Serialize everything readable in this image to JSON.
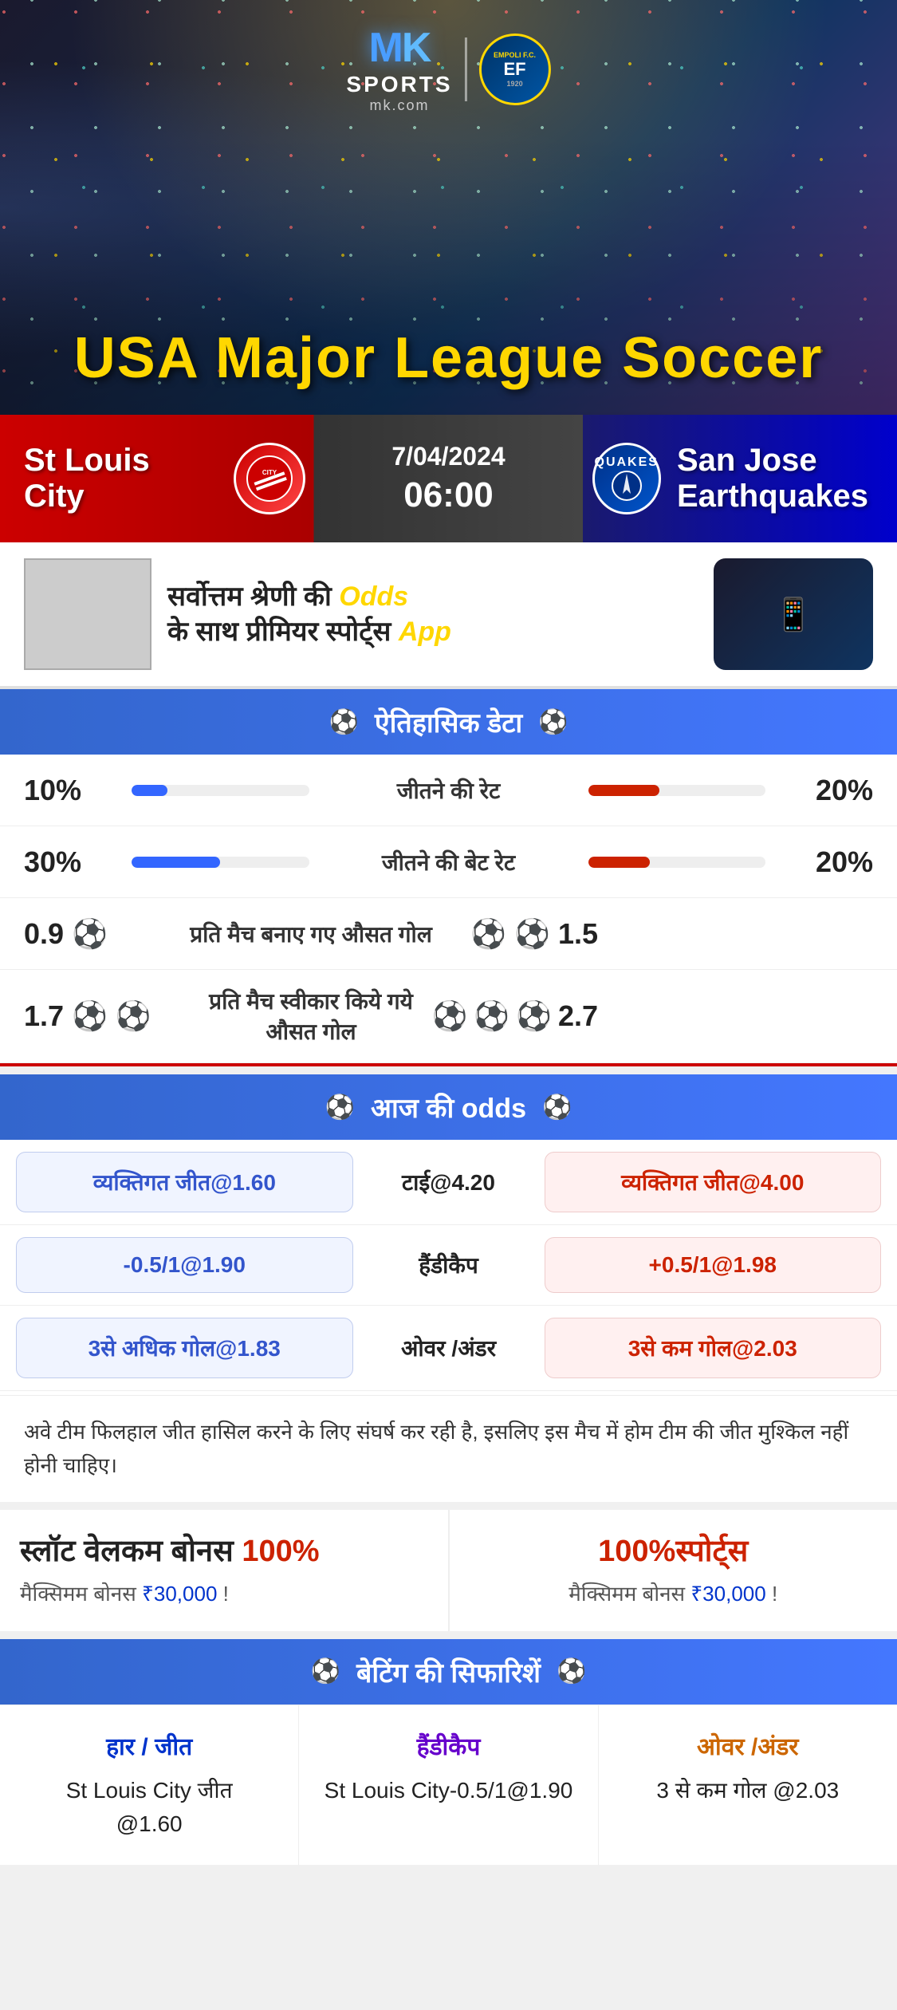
{
  "brand": {
    "mk": "MK",
    "sports": "SPORTS",
    "domain": "mk.com",
    "empoli": "EMPOLI F.C.\n1920"
  },
  "hero": {
    "title": "USA Major League Soccer"
  },
  "match": {
    "team_home": "St Louis City",
    "team_away": "San Jose Earthquakes",
    "date": "7/04/2024",
    "time": "06:00",
    "quakes_label": "QUAKES"
  },
  "promo": {
    "text_line1": "सर्वोत्तम श्रेणी की",
    "text_highlight": "Odds",
    "text_line2": "के साथ प्रीमियर स्पोर्ट्स",
    "text_app": "App"
  },
  "historical": {
    "section_title": "ऐतिहासिक डेटा",
    "rows": [
      {
        "label": "जीतने की रेट",
        "left_val": "10%",
        "right_val": "20%",
        "left_fill": 20,
        "right_fill": 40
      },
      {
        "label": "जीतने की बेट रेट",
        "left_val": "30%",
        "right_val": "20%",
        "left_fill": 50,
        "right_fill": 35
      }
    ],
    "icon_rows": [
      {
        "label": "प्रति मैच बनाए गए औसत गोल",
        "left_val": "0.9",
        "right_val": "1.5",
        "left_balls": 1,
        "right_balls": 2
      },
      {
        "label": "प्रति मैच स्वीकार किये गये औसत गोल",
        "left_val": "1.7",
        "right_val": "2.7",
        "left_balls": 2,
        "right_balls": 3
      }
    ]
  },
  "odds": {
    "section_title": "आज की odds",
    "rows": [
      {
        "left": "व्यक्तिगत जीत@1.60",
        "center": "टाई@4.20",
        "right": "व्यक्तिगत जीत@4.00",
        "right_red": true
      },
      {
        "left": "-0.5/1@1.90",
        "center": "हैंडीकैप",
        "right": "+0.5/1@1.98",
        "right_red": true
      },
      {
        "left": "3से अधिक गोल@1.83",
        "center": "ओवर /अंडर",
        "right": "3से कम गोल@2.03",
        "right_red": true
      }
    ]
  },
  "analysis": {
    "text": "अवे टीम फिलहाल जीत हासिल करने के लिए संघर्ष कर रही है, इसलिए इस मैच में होम टीम की जीत मुश्किल नहीं होनी चाहिए।"
  },
  "bonus": {
    "left_title_part1": "स्लॉट वेलकम बोनस",
    "left_pct": "100%",
    "left_subtitle": "मैक्सिमम बोनस",
    "left_amount": "₹30,000",
    "left_excl": "!",
    "right_pct": "100%",
    "right_title": "स्पोर्ट्स",
    "right_subtitle": "मैक्सिमम बोनस",
    "right_amount": "₹30,000",
    "right_excl": "!"
  },
  "recommendations": {
    "section_title": "बेटिंग की सिफारिशें",
    "cols": [
      {
        "title": "हार / जीत",
        "color": "blue",
        "value_line1": "St Louis City जीत",
        "value_line2": "@1.60"
      },
      {
        "title": "हैंडीकैप",
        "color": "purple",
        "value_line1": "St Louis City-0.5/1@1.90"
      },
      {
        "title": "ओवर /अंडर",
        "color": "orange",
        "value_line1": "3 से कम गोल @2.03"
      }
    ]
  }
}
